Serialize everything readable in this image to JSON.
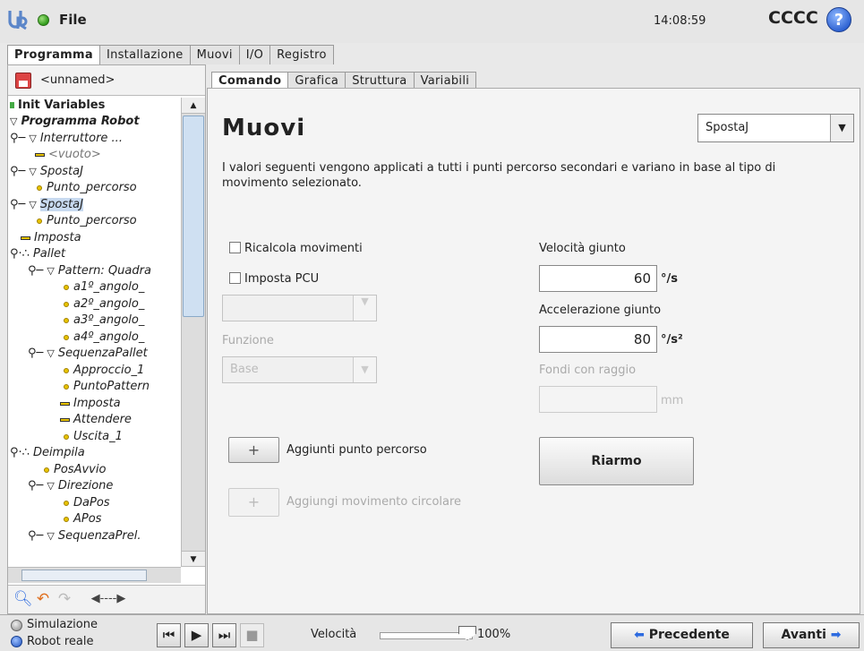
{
  "topbar": {
    "menu_file": "File",
    "clock": "14:08:59",
    "robot_name": "CCCC",
    "help_glyph": "?"
  },
  "main_tabs": [
    "Programma",
    "Installazione",
    "Muovi",
    "I/O",
    "Registro"
  ],
  "left": {
    "program_name": "<unnamed>",
    "tree": [
      "Init Variables",
      "Programma Robot",
      "Interruttore ...",
      "<vuoto>",
      "SpostaJ",
      "Punto_percorso",
      "SpostaJ",
      "Punto_percorso",
      "Imposta",
      "Pallet",
      "Pattern: Quadra",
      "a1º_angolo_",
      "a2º_angolo_",
      "a3º_angolo_",
      "a4º_angolo_",
      "SequenzaPallet",
      "Approccio_1",
      "PuntoPattern",
      "Imposta",
      "Attendere",
      "Uscita_1",
      "Deimpila",
      "PosAvvio",
      "Direzione",
      "DaPos",
      "APos",
      "SequenzaPrel."
    ]
  },
  "sub_tabs": [
    "Comando",
    "Grafica",
    "Struttura",
    "Variabili"
  ],
  "command": {
    "title": "Muovi",
    "move_type": "SpostaJ",
    "description": "I valori seguenti vengono applicati a tutti i punti percorso secondari e variano in base al tipo di movimento selezionato.",
    "recalc_label": "Ricalcola movimenti",
    "set_tcp_label": "Imposta PCU",
    "function_label": "Funzione",
    "function_value": "Base",
    "joint_speed_label": "Velocità giunto",
    "joint_speed_value": "60",
    "joint_speed_unit": "°/s",
    "joint_accel_label": "Accelerazione giunto",
    "joint_accel_value": "80",
    "joint_accel_unit": "°/s²",
    "blend_label": "Fondi con raggio",
    "blend_unit": "mm",
    "add_waypoint_label": "Aggiunti punto percorso",
    "add_circle_label": "Aggiungi movimento circolare",
    "rearm_label": "Riarmo",
    "plus_glyph": "+"
  },
  "bottom": {
    "simulation_label": "Simulazione",
    "real_robot_label": "Robot reale",
    "speed_label": "Velocità",
    "speed_value": "100%",
    "speed_fraction": 1.0,
    "prev_label": "Precedente",
    "next_label": "Avanti"
  },
  "colors": {
    "accent_blue": "#2d6be0",
    "selection": "#c8daf0",
    "tcp_yellow": "#e8c300"
  }
}
